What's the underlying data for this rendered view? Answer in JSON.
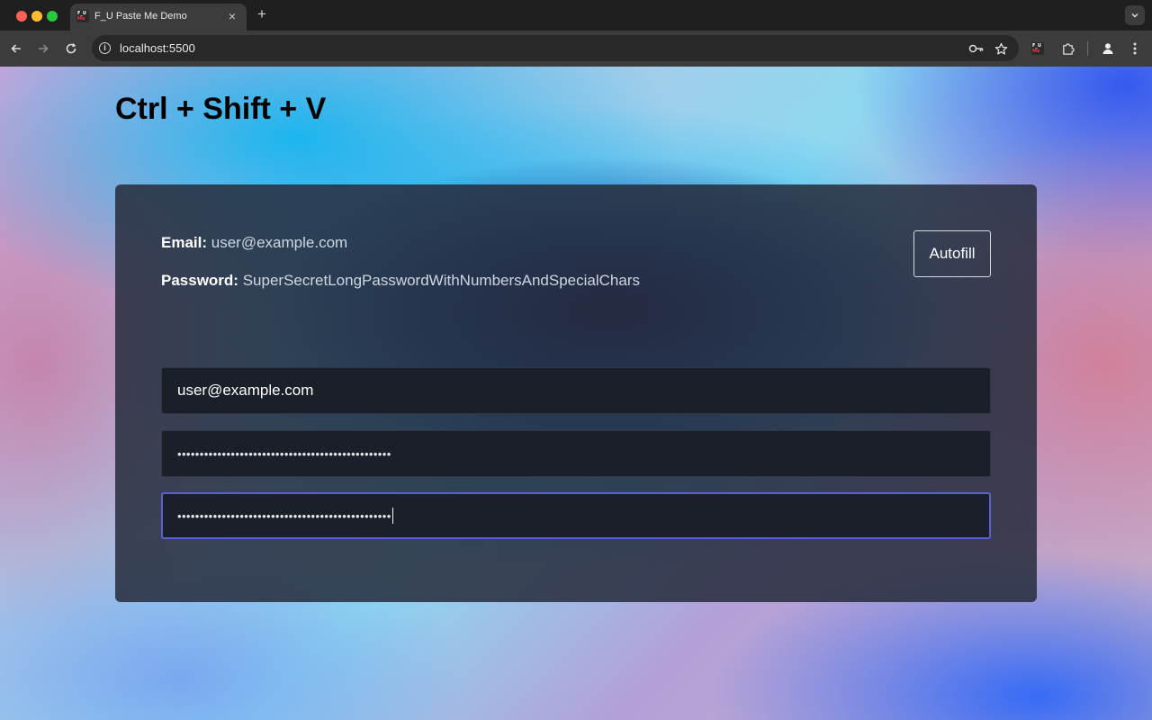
{
  "browser": {
    "tab_title": "F_U Paste Me Demo",
    "favicon_text": "F_U Me",
    "url": "localhost:5500",
    "extension_icon_text": "F_U Me"
  },
  "page": {
    "title": "Ctrl + Shift + V",
    "credentials": {
      "email_label": "Email:",
      "email_value": "user@example.com",
      "password_label": "Password:",
      "password_value": "SuperSecretLongPasswordWithNumbersAndSpecialChars"
    },
    "autofill_label": "Autofill",
    "fields": {
      "email_value": "user@example.com",
      "password_masked": "••••••••••••••••••••••••••••••••••••••••••••••••",
      "confirm_masked": "••••••••••••••••••••••••••••••••••••••••••••••••"
    }
  }
}
